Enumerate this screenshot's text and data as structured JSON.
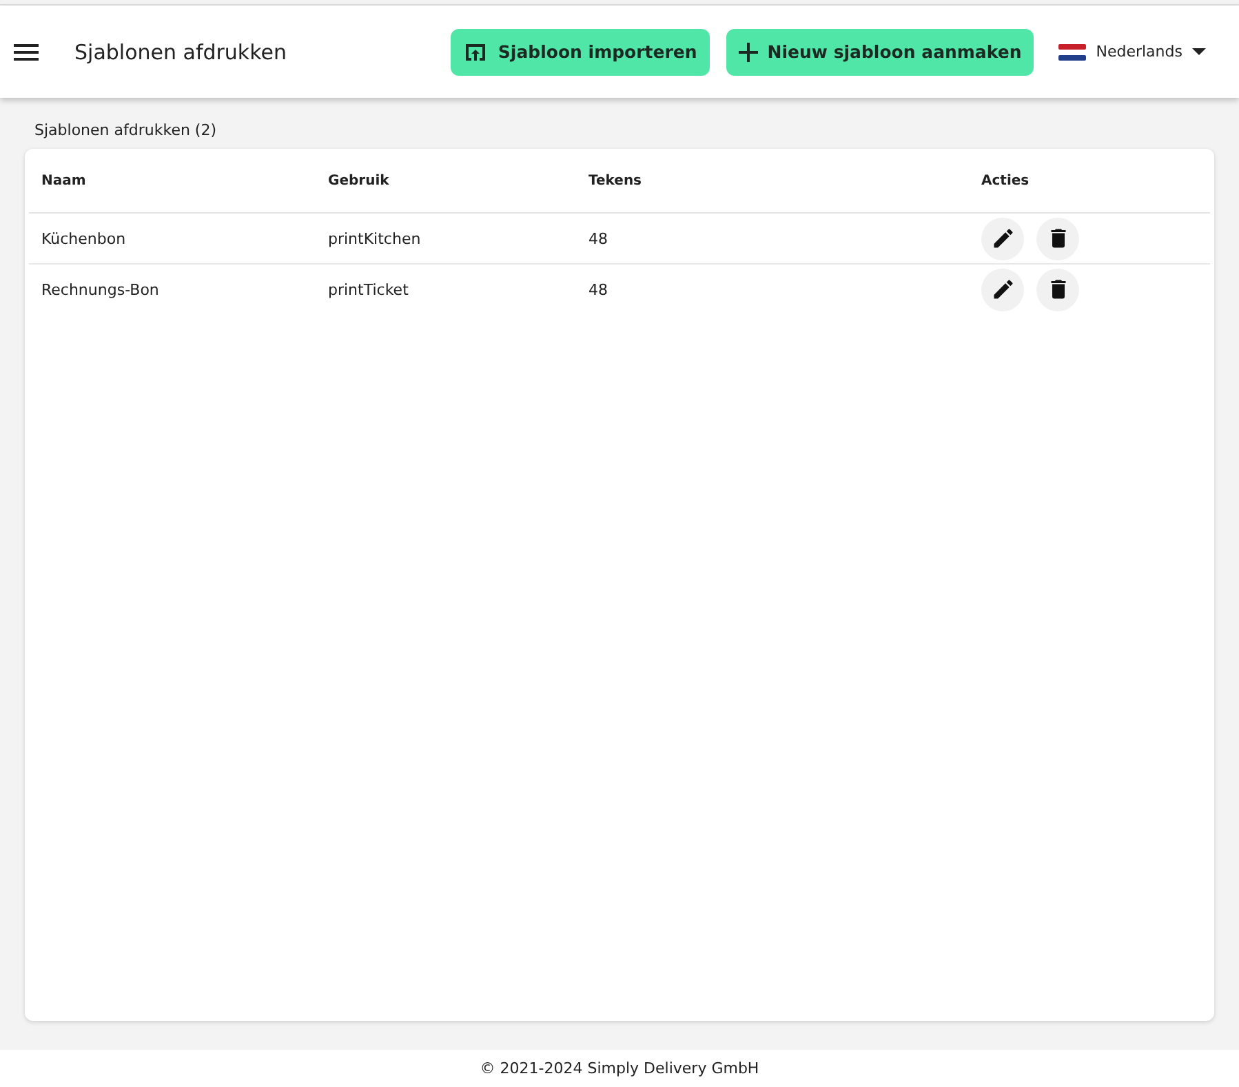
{
  "header": {
    "title": "Sjablonen afdrukken",
    "buttons": [
      {
        "kind": "import",
        "label": "Sjabloon importeren"
      },
      {
        "kind": "add",
        "label": "Nieuw sjabloon aanmaken"
      }
    ],
    "language": "Nederlands"
  },
  "caption": "Sjablonen afdrukken (2)",
  "table": {
    "columns": [
      "Naam",
      "Gebruik",
      "Tekens",
      "Acties"
    ],
    "rows": [
      {
        "name": "Küchenbon",
        "usage": "printKitchen",
        "chars": "48"
      },
      {
        "name": "Rechnungs-Bon",
        "usage": "printTicket",
        "chars": "48"
      }
    ]
  },
  "footer": "© 2021-2024 Simply Delivery GmbH"
}
